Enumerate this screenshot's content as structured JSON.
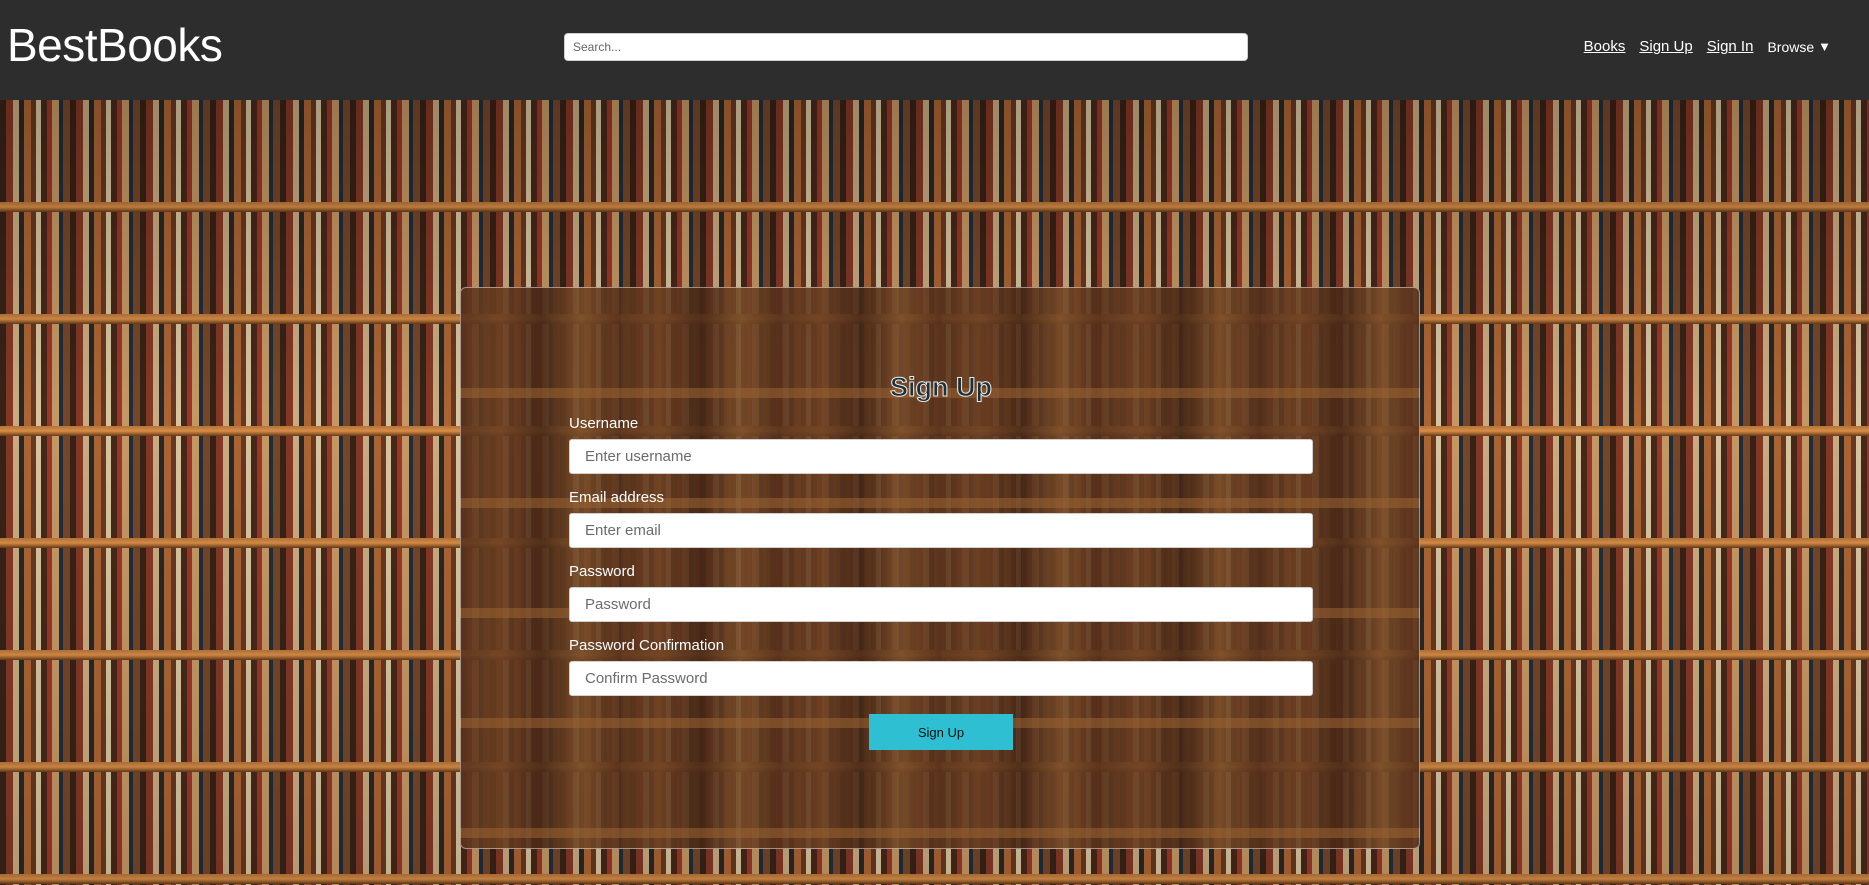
{
  "header": {
    "brand": "BestBooks",
    "search_placeholder": "Search...",
    "nav": {
      "books": "Books",
      "sign_up": "Sign Up",
      "sign_in": "Sign In",
      "browse": "Browse",
      "browse_caret": "▼"
    }
  },
  "form": {
    "title": "Sign Up",
    "fields": [
      {
        "label": "Username",
        "placeholder": "Enter username",
        "value": ""
      },
      {
        "label": "Email address",
        "placeholder": "Enter email",
        "value": ""
      },
      {
        "label": "Password",
        "placeholder": "Password",
        "value": ""
      },
      {
        "label": "Password Confirmation",
        "placeholder": "Confirm Password",
        "value": ""
      }
    ],
    "submit_label": "Sign Up"
  },
  "colors": {
    "header_bg": "#2d2d2d",
    "submit_bg": "#2fbfd3",
    "label_text": "#ffffff"
  },
  "icons": {
    "browse_dropdown": "caret-down-icon"
  }
}
